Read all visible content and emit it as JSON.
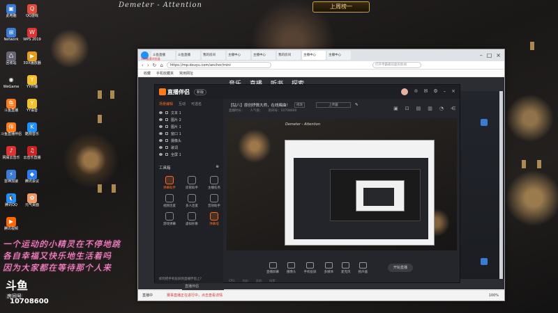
{
  "banner": {
    "text": "Demeter  -  Attention",
    "badge": "上周榜一"
  },
  "desktop": [
    {
      "label": "此电脑",
      "color": "#3a7bd5",
      "glyph": "▣"
    },
    {
      "label": "QQ游戏",
      "color": "#e14b3b",
      "glyph": "Q"
    },
    {
      "label": "Network",
      "color": "#3a7bd5",
      "glyph": "⊞"
    },
    {
      "label": "WPS 2019",
      "color": "#d33",
      "glyph": "W"
    },
    {
      "label": "回收站",
      "color": "#667",
      "glyph": "♺"
    },
    {
      "label": "3DX播放器",
      "color": "#e69b1a",
      "glyph": "▶"
    },
    {
      "label": "WeGame",
      "color": "#222",
      "glyph": "◉"
    },
    {
      "label": "YY开播",
      "color": "#f2c12e",
      "glyph": "Y"
    },
    {
      "label": "斗鱼直播",
      "color": "#ff7a1a",
      "glyph": "鱼"
    },
    {
      "label": "YY语音",
      "color": "#f2c12e",
      "glyph": "Y"
    },
    {
      "label": "斗鱼直播伴侣",
      "color": "#ff7a1a",
      "glyph": "伴"
    },
    {
      "label": "酷狗音乐",
      "color": "#1e90ff",
      "glyph": "K"
    },
    {
      "label": "网易云音乐",
      "color": "#d33",
      "glyph": "♪"
    },
    {
      "label": "云音乐直播",
      "color": "#c22",
      "glyph": "♫"
    },
    {
      "label": "雷神加速",
      "color": "#3a7bd5",
      "glyph": "⚡"
    },
    {
      "label": "腾讯会议",
      "color": "#2d7bf0",
      "glyph": "◆"
    },
    {
      "label": "腾讯QQ",
      "color": "#1e90ff",
      "glyph": "🐧"
    },
    {
      "label": "元气桌面",
      "color": "#e96",
      "glyph": "✿"
    },
    {
      "label": "腾讯视频",
      "color": "#f60",
      "glyph": "▶"
    }
  ],
  "browser": {
    "brand": "360极速浏览器",
    "tabs": [
      "斗鱼直播",
      "斗鱼直播",
      "我的房间",
      "主播中心",
      "主播中心",
      "我的房间",
      "主播中心",
      "主播中心"
    ],
    "active_tab": 6,
    "url": "https://mp.douyu.com/anchor/mini",
    "search_placeholder": "打开帝霸最前面的新闻",
    "bookmarks": [
      "收藏",
      "手机收藏夹",
      "常用网址"
    ],
    "page_nav": [
      "音乐",
      "直播",
      "听书",
      "探索"
    ],
    "status_text": "直播中",
    "status_news": "赛事直播正在进行中，点击查看详情",
    "zoom": "100%"
  },
  "app": {
    "name": "直播伴侣",
    "version": "新版",
    "side_tabs": [
      "场景编辑",
      "互动",
      "可选名"
    ],
    "sources": [
      "文本 1",
      "图片 2",
      "图片 1",
      "窗口 1",
      "摄像头",
      "歌词",
      "全屏 1"
    ],
    "tools_title": "工具箱",
    "tools": [
      {
        "label": "弹幕助手",
        "hot": true
      },
      {
        "label": "房管助手",
        "hot": false
      },
      {
        "label": "主播任务",
        "hot": false
      },
      {
        "label": "视频连麦",
        "hot": false
      },
      {
        "label": "多人连麦",
        "hot": false
      },
      {
        "label": "音效助手",
        "hot": false
      },
      {
        "label": "游戏弹幕",
        "hot": false
      },
      {
        "label": "虚拟形象",
        "hot": false
      },
      {
        "label": "弹幕墙",
        "hot": true
      }
    ],
    "side_footer": "如何把手机投屏到直播伴侣上?",
    "room_title": "【钻八】原创抒情大师，在线赐曲！",
    "edit_label": "修改",
    "category": "上传酱",
    "meta": [
      "直播时长：",
      "人气值：",
      "房间号：10708600"
    ],
    "toolbar": [
      "直播屏幕",
      "摄像头",
      "手机投屏",
      "多媒体",
      "麦克风",
      "扬声器"
    ],
    "start_label": "开始直播",
    "stats": [
      "CPU:",
      "内存:",
      "丢帧:",
      "码率:"
    ],
    "taskbar_label": "直播伴侣"
  },
  "lyrics": [
    "一个运动的小精灵在不停地跳",
    "各自幸福又快乐地生活着吗",
    "因为大家都在等待那个人来"
  ],
  "room": {
    "brand": "斗鱼",
    "label": "房间号",
    "id": "10708600"
  }
}
